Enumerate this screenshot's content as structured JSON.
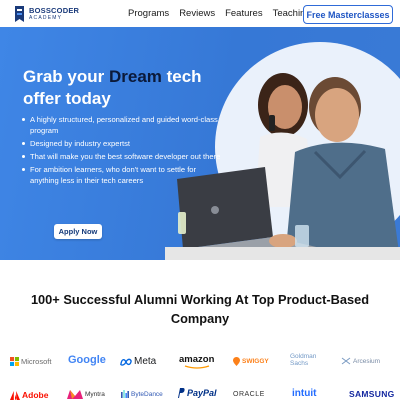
{
  "brand": {
    "name": "BOSSCODER",
    "sub": "ACADEMY"
  },
  "nav": {
    "links": [
      "Programs",
      "Reviews",
      "Features",
      "Teaching"
    ],
    "cta": "Free Masterclasses"
  },
  "hero": {
    "title_pre": "Grab your ",
    "title_highlight": "Dream",
    "title_post": " tech offer today",
    "bullets": [
      "A highly structured, personalized and guided word-class program",
      "Designed by industry expertst",
      "That will make you the best software developer out there",
      "For ambition learners, who don't want to settle for anything less in their tech careers"
    ],
    "apply_label": "Apply Now"
  },
  "alumni": {
    "title": "100+ Successful Alumni Working At Top Product-Based Company"
  },
  "companies_row1": [
    "Microsoft",
    "Google",
    "Meta",
    "amazon",
    "SWIGGY",
    "Goldman Sachs",
    "Arcesium"
  ],
  "companies_row2": [
    "Adobe",
    "Myntra",
    "ByteDance",
    "PayPal",
    "ORACLE",
    "intuit",
    "SAMSUNG"
  ],
  "colors": {
    "hero_blue": "#3a7ddc",
    "brand_dark": "#1a3a7a",
    "cta_blue": "#1f56c4"
  }
}
